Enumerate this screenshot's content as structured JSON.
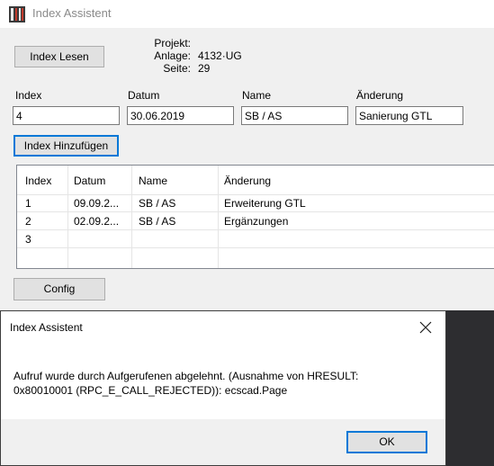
{
  "window": {
    "title": "Index Assistent"
  },
  "toolbar": {
    "index_lesen_label": "Index Lesen",
    "index_hinzufuegen_label": "Index Hinzufügen",
    "config_label": "Config"
  },
  "project_info": {
    "projekt_label": "Projekt:",
    "projekt_value": "",
    "anlage_label": "Anlage:",
    "anlage_value": "4132·UG",
    "seite_label": "Seite:",
    "seite_value": "29"
  },
  "form": {
    "index_label": "Index",
    "index_value": "4",
    "datum_label": "Datum",
    "datum_value": "30.06.2019",
    "name_label": "Name",
    "name_value": "SB / AS",
    "aenderung_label": "Änderung",
    "aenderung_value": "Sanierung GTL"
  },
  "grid": {
    "columns": [
      "Index",
      "Datum",
      "Name",
      "Änderung"
    ],
    "rows": [
      {
        "index": "1",
        "datum": "09.09.2...",
        "name": "SB / AS",
        "aenderung": "Erweiterung GTL"
      },
      {
        "index": "2",
        "datum": "02.09.2...",
        "name": "SB / AS",
        "aenderung": "Ergänzungen"
      },
      {
        "index": "3",
        "datum": "",
        "name": "",
        "aenderung": ""
      }
    ]
  },
  "dialog": {
    "title": "Index Assistent",
    "message_line1": "Aufruf wurde durch Aufgerufenen abgelehnt. (Ausnahme von HRESULT:",
    "message_line2": "0x80010001 (RPC_E_CALL_REJECTED)): ecscad.Page",
    "ok_label": "OK",
    "close_icon": "close-icon"
  },
  "colors": {
    "focus_border": "#0078d7",
    "window_bg": "#f0f0f0",
    "background_dark": "#2d2d30"
  },
  "icons": {
    "app": "app-icon"
  }
}
